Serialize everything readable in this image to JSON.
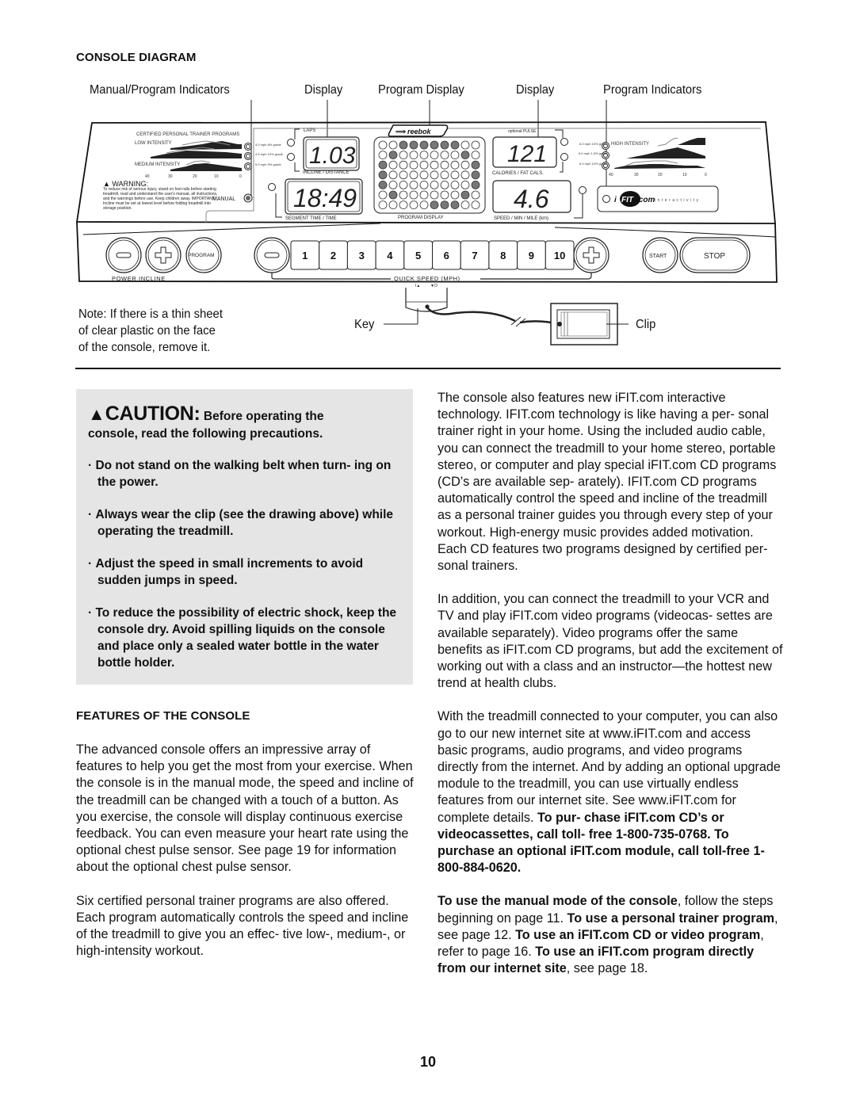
{
  "page": {
    "section_title": "CONSOLE DIAGRAM",
    "page_number": "10"
  },
  "diagram": {
    "callouts": [
      "Manual/Program Indicators",
      "Display",
      "Program Display",
      "Display",
      "Program Indicators"
    ],
    "console": {
      "trainer_programs_title": "CERTIFIED PERSONAL TRAINER PROGRAMS",
      "low_intensity": "LOW INTENSITY",
      "medium_intensity": "MEDIUM INTENSITY",
      "high_intensity": "HIGH INTENSITY",
      "left_grades": [
        "4.0 mph 8% grade",
        "4.5 mph 10% grade",
        "5.0 mph 5% grade"
      ],
      "right_grades": [
        "6.0 mph 10% grade",
        "6.0 mph 1.5% grade",
        "6.0 mph 10% grade"
      ],
      "axis_ticks": [
        "40",
        "30",
        "20",
        "10",
        "0"
      ],
      "warning_title": "WARNING:",
      "warning_text": "To reduce risk of serious injury, stand on foot rails before starting treadmill, read and understand the user's manual, all instructions, and the warnings before use. Keep children away. IMPORTANT: Incline must be set at lowest level before folding treadmill into storage position.",
      "manual_label": "MANUAL",
      "laps_label": "LAPS",
      "incline_distance_label": "INCLINE / DISTANCE",
      "segment_time_label": "SEGMENT TIME  /  TIME",
      "program_display_label": "PROGRAM DISPLAY",
      "pulse_label": "optional PULSE",
      "calories_label": "CALORIES / FAT CALS.",
      "speed_label": "SPEED  /  MIN / MILE (km)",
      "brand": "reebok",
      "ifit_logo": "iFIT.com",
      "ifit_tagline": "interactivity",
      "display_values": {
        "incline_distance": "1.03",
        "time": "18:49",
        "calories": "121",
        "speed": "4.6"
      },
      "program_matrix": [
        [
          0,
          0,
          1,
          1,
          1,
          1,
          1,
          1,
          0,
          0
        ],
        [
          0,
          1,
          0,
          0,
          0,
          0,
          0,
          0,
          1,
          0
        ],
        [
          1,
          0,
          0,
          0,
          0,
          0,
          0,
          0,
          0,
          1
        ],
        [
          1,
          0,
          0,
          0,
          0,
          0,
          0,
          0,
          0,
          1
        ],
        [
          1,
          0,
          0,
          0,
          0,
          0,
          0,
          0,
          0,
          1
        ],
        [
          0,
          1,
          0,
          0,
          0,
          0,
          0,
          0,
          1,
          0
        ],
        [
          0,
          0,
          0,
          0,
          0,
          1,
          1,
          1,
          0,
          0
        ]
      ],
      "power_incline_label": "POWER INCLINE",
      "program_button": "PROGRAM",
      "quick_speed_label": "QUICK SPEED (MPH)",
      "speed_keys": [
        "1",
        "2",
        "3",
        "4",
        "5",
        "6",
        "7",
        "8",
        "9",
        "10"
      ],
      "start_button": "START",
      "stop_button": "STOP"
    },
    "note": [
      "Note: If there is a thin sheet",
      "of clear plastic on the face",
      "of the console, remove it."
    ],
    "key_label": "Key",
    "clip_label": "Clip"
  },
  "caution": {
    "word": "CAUTION:",
    "lead": "Before operating the",
    "line2": "console, read the following precautions.",
    "bullets": [
      "Do not stand on the walking belt when turn- ing on the power.",
      "Always wear the clip (see the drawing above) while operating the treadmill.",
      "Adjust the speed in small increments to avoid sudden jumps in speed.",
      "To reduce the possibility of electric shock, keep the console dry. Avoid spilling liquids on the console and place only a sealed water bottle in the water bottle holder."
    ]
  },
  "features": {
    "title": "FEATURES OF THE CONSOLE",
    "p1": "The advanced console offers an impressive array of features to help you get the most from your exercise. When the console is in the manual mode, the speed and incline of the treadmill can be changed with a touch of a button. As you exercise, the console will display continuous exercise feedback. You can even measure your heart rate using the optional chest pulse sensor. See page 19 for information about the optional chest pulse sensor.",
    "p2": "Six certified personal trainer programs are also offered. Each program automatically controls the speed and incline of the treadmill to give you an effec- tive low-, medium-, or high-intensity workout."
  },
  "right_column": {
    "p1": "The console also features new iFIT.com interactive technology. IFIT.com technology is like having a per- sonal trainer right in your home. Using the included audio cable, you can connect the treadmill to your home stereo, portable stereo, or computer and play special iFIT.com CD programs (CD’s are available sep- arately). IFIT.com CD programs automatically control the speed and incline of the treadmill as a personal trainer guides you through every step of your workout. High-energy music provides added motivation. Each CD features two programs designed by certified per- sonal trainers.",
    "p2": "In addition, you can connect the treadmill to your VCR and TV and play iFIT.com video programs (videocas- settes are available separately). Video programs offer the same benefits as iFIT.com CD programs, but add the excitement of working out with a class and an instructor—the hottest new trend at health clubs.",
    "p3_normal": "With the treadmill connected to your computer, you can also go to our new internet site at www.iFIT.com and access basic programs, audio programs, and video programs directly from the internet. And by adding an optional upgrade module to the treadmill, you can use virtually endless features from our internet site. See www.iFIT.com for complete details. ",
    "p3_bold": "To pur- chase iFIT.com CD’s or videocassettes, call toll- free 1-800-735-0768. To purchase an optional iFIT.com module, call toll-free 1-800-884-0620.",
    "p4": [
      {
        "b": "To use the manual mode of the console",
        "t": ", follow the steps beginning on page 11. "
      },
      {
        "b": "To use a personal trainer program",
        "t": ", see page 12. "
      },
      {
        "b": "To use an iFIT.com CD or video program",
        "t": ", refer to page 16. "
      },
      {
        "b": "To use an iFIT.com program directly from our internet site",
        "t": ", see page 18."
      }
    ]
  }
}
